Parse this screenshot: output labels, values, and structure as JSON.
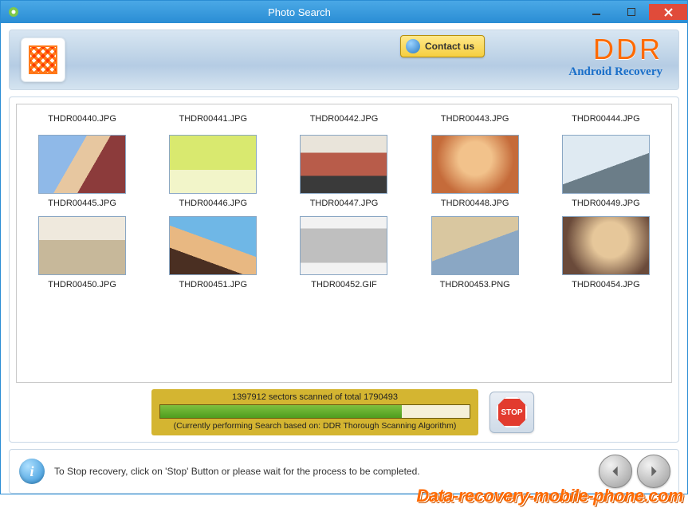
{
  "window": {
    "title": "Photo Search"
  },
  "header": {
    "contact_label": "Contact us",
    "brand": "DDR",
    "brand_sub": "Android Recovery"
  },
  "files": [
    {
      "name": "THDR00440.JPG",
      "thumb": false
    },
    {
      "name": "THDR00441.JPG",
      "thumb": false
    },
    {
      "name": "THDR00442.JPG",
      "thumb": false
    },
    {
      "name": "THDR00443.JPG",
      "thumb": false
    },
    {
      "name": "THDR00444.JPG",
      "thumb": false
    },
    {
      "name": "THDR00445.JPG",
      "thumb": true,
      "cls": "ph1"
    },
    {
      "name": "THDR00446.JPG",
      "thumb": true,
      "cls": "ph2"
    },
    {
      "name": "THDR00447.JPG",
      "thumb": true,
      "cls": "ph3"
    },
    {
      "name": "THDR00448.JPG",
      "thumb": true,
      "cls": "ph4"
    },
    {
      "name": "THDR00449.JPG",
      "thumb": true,
      "cls": "ph5"
    },
    {
      "name": "THDR00450.JPG",
      "thumb": true,
      "cls": "ph6"
    },
    {
      "name": "THDR00451.JPG",
      "thumb": true,
      "cls": "ph7"
    },
    {
      "name": "THDR00452.GIF",
      "thumb": true,
      "cls": "ph8"
    },
    {
      "name": "THDR00453.PNG",
      "thumb": true,
      "cls": "ph9"
    },
    {
      "name": "THDR00454.JPG",
      "thumb": true,
      "cls": "ph10"
    }
  ],
  "progress": {
    "scanned": 1397912,
    "total": 1790493,
    "status_line": "1397912 sectors scanned of total 1790493",
    "algo_line": "(Currently performing Search based on:  DDR Thorough Scanning Algorithm)",
    "percent": 78
  },
  "stop": {
    "label": "STOP"
  },
  "footer": {
    "hint": "To Stop recovery, click on 'Stop' Button or please wait for the process to be completed."
  },
  "watermark": "Data-recovery-mobile-phone.com"
}
